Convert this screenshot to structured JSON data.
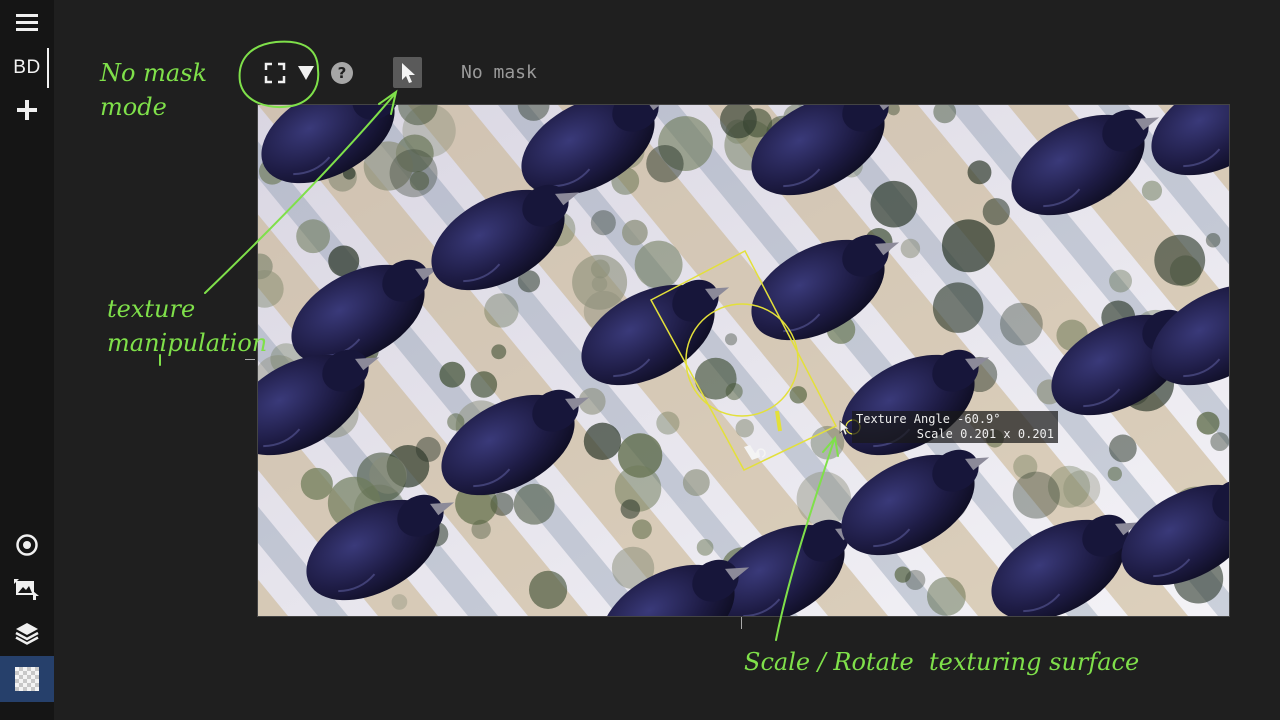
{
  "sidebar": {
    "brand": "BD",
    "items": [
      {
        "icon": "menu-icon"
      },
      {
        "icon": "plus-icon"
      },
      {
        "icon": "target-icon"
      },
      {
        "icon": "image-transform-icon"
      },
      {
        "icon": "layers-icon"
      },
      {
        "icon": "checkerboard-icon"
      }
    ]
  },
  "toolbar": {
    "mask_mode_icon": "selection-brackets-icon",
    "dropdown_icon": "triangle-down-icon",
    "help_icon": "question-circle-icon",
    "pointer_icon": "cursor-arrow-icon",
    "mask_status": "No mask"
  },
  "tooltip": {
    "line1": "Texture Angle -60.9°",
    "line2": "Scale 0.201 x 0.201"
  },
  "annotations": {
    "no_mask_mode": "No mask\nmode",
    "texture_manipulation": "texture\nmanipulation",
    "scale_rotate": "Scale / Rotate  texturing surface"
  },
  "colors": {
    "annotation": "#7fe04a",
    "gizmo": "#e3e03a",
    "active_tool": "#26406b"
  }
}
